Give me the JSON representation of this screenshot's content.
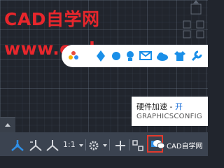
{
  "watermark": {
    "title": "CAD自学网",
    "url": "www.cadzxw.com"
  },
  "tooltip": {
    "label": "硬件加速 - ",
    "state": "开",
    "command": "GRAPHICSCONFIG"
  },
  "status_bar": {
    "annotation_scale": "1:1",
    "wechat_account": "CAD自学网"
  },
  "icons": {
    "float_toolbar": [
      "flower-icon",
      "flower-icon",
      "flower-icon",
      "bulb-icon",
      "email-icon",
      "cloud-icon",
      "shirt-icon",
      "wrench-icon"
    ],
    "status_bar": [
      "annotation-scale-icon",
      "annotation-visibility-icon",
      "auto-scale-icon",
      "gear-icon",
      "plus-icon",
      "isolate-icon",
      "hardware-acceleration-icon"
    ]
  },
  "colors": {
    "watermark": "#e8262c",
    "accent_blue": "#1a8fe8",
    "highlight_border": "#e23a2d",
    "status_bar_bg": "#3b4350",
    "canvas_bg": "#21252d"
  }
}
